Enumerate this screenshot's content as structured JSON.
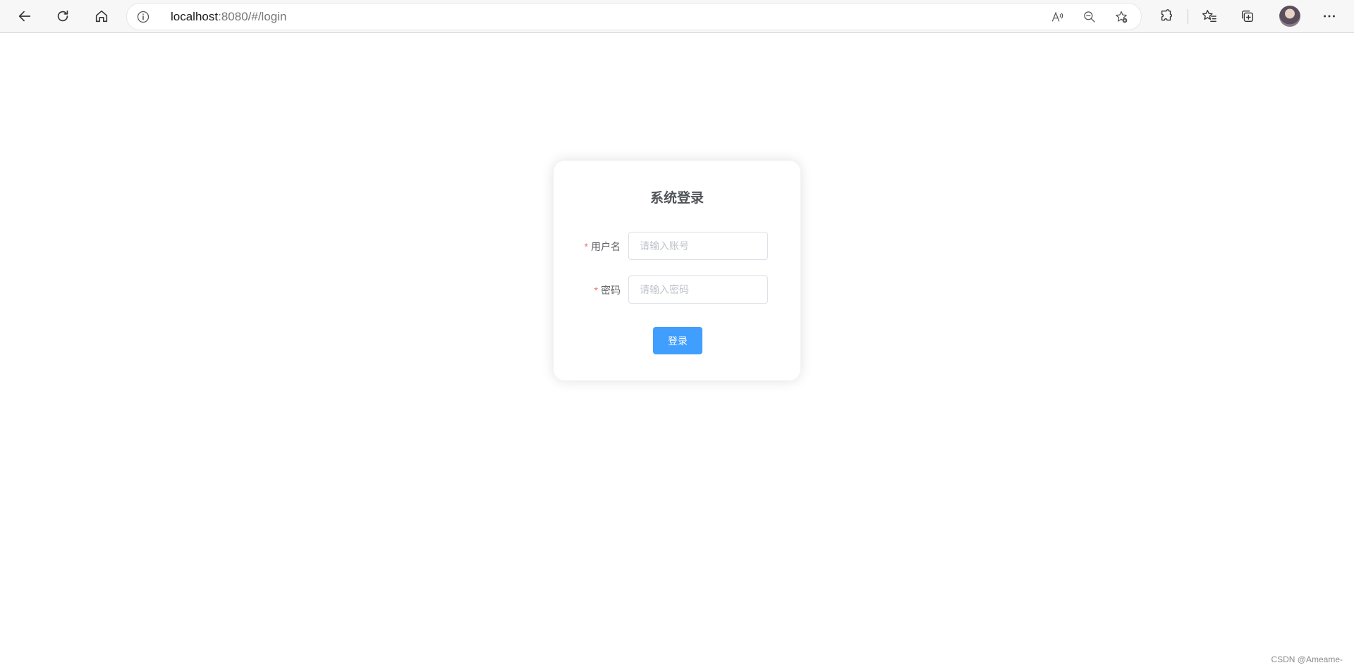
{
  "browser": {
    "url_host": "localhost",
    "url_rest": ":8080/#/login"
  },
  "login": {
    "title": "系统登录",
    "username_label": "用户名",
    "username_placeholder": "请输入账号",
    "username_value": "",
    "password_label": "密码",
    "password_placeholder": "请输入密码",
    "password_value": "",
    "required_mark": "*",
    "submit_label": "登录"
  },
  "watermark": "CSDN @Ameame-",
  "colors": {
    "primary": "#409eff",
    "required": "#f56c6c",
    "title": "#505458"
  },
  "icons": [
    "back-icon",
    "refresh-icon",
    "home-icon",
    "info-icon",
    "read-aloud-icon",
    "zoom-out-icon",
    "add-favorite-icon",
    "extensions-icon",
    "favorites-icon",
    "collections-icon",
    "avatar",
    "more-icon"
  ]
}
